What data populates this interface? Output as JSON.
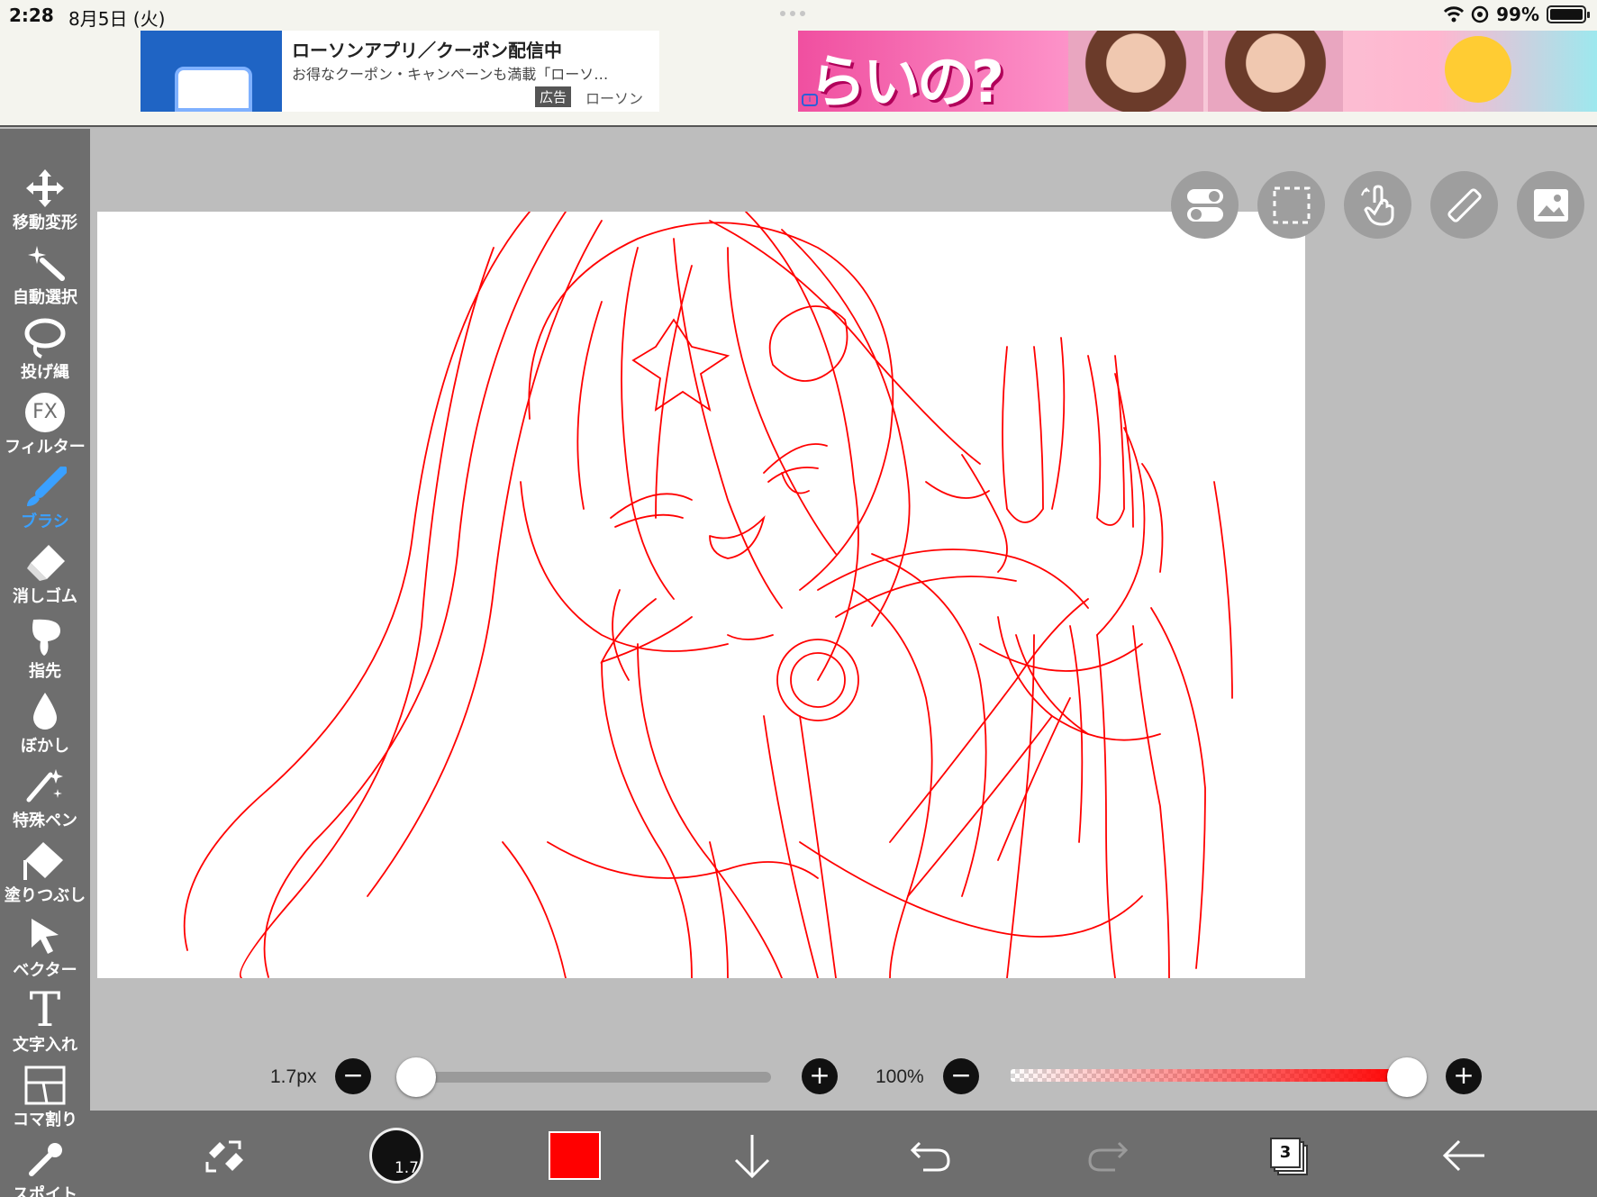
{
  "status": {
    "time": "2:28",
    "date": "8月5日 (火)",
    "battery": "99%",
    "icons": [
      "wifi-icon",
      "at-icon",
      "battery-icon"
    ]
  },
  "ads": {
    "ad1": {
      "title": "ローソンアプリ／クーポン配信中",
      "description": "お得なクーポン・キャンペーンも満載「ローソ…",
      "badge": "広告",
      "advertiser": "ローソン"
    },
    "ad2": {
      "text": "らいの?"
    }
  },
  "toolbar": {
    "active": "brush",
    "tools": [
      {
        "label": "移動変形",
        "icon": "move-transform-icon"
      },
      {
        "label": "自動選択",
        "icon": "magic-wand-icon"
      },
      {
        "label": "投げ縄",
        "icon": "lasso-icon"
      },
      {
        "label": "フィルター",
        "icon": "fx-icon",
        "icon_text": "FX"
      },
      {
        "label": "ブラシ",
        "icon": "brush-icon"
      },
      {
        "label": "消しゴム",
        "icon": "eraser-icon"
      },
      {
        "label": "指先",
        "icon": "finger-smudge-icon"
      },
      {
        "label": "ぼかし",
        "icon": "blur-drop-icon"
      },
      {
        "label": "特殊ペン",
        "icon": "special-pen-icon"
      },
      {
        "label": "塗りつぶし",
        "icon": "bucket-fill-icon"
      },
      {
        "label": "ベクター",
        "icon": "vector-cursor-icon"
      },
      {
        "label": "文字入れ",
        "icon": "text-icon",
        "icon_text": "T"
      },
      {
        "label": "コマ割り",
        "icon": "panel-split-icon"
      },
      {
        "label": "スポイト",
        "icon": "eyedropper-icon"
      }
    ]
  },
  "canvas_buttons": [
    "toggle-icon",
    "selection-icon",
    "hand-gesture-icon",
    "ruler-icon",
    "image-icon"
  ],
  "brush": {
    "size_label": "1.7px",
    "size_fraction": 0.0,
    "opacity_label": "100%",
    "opacity_fraction": 1.0,
    "color": "#ff0000"
  },
  "bottom": {
    "brush_size": "1.7",
    "layer_count": "3",
    "icons": [
      "swap-tool-icon",
      "brush-size-icon",
      "color-swatch",
      "download-icon",
      "undo-icon",
      "redo-icon",
      "layers-icon",
      "back-icon"
    ]
  },
  "colors": {
    "toolbar": "#6e6e6e",
    "workspace": "#bdbdbd",
    "accent": "#3aa0ff",
    "stroke": "#ff0000"
  }
}
